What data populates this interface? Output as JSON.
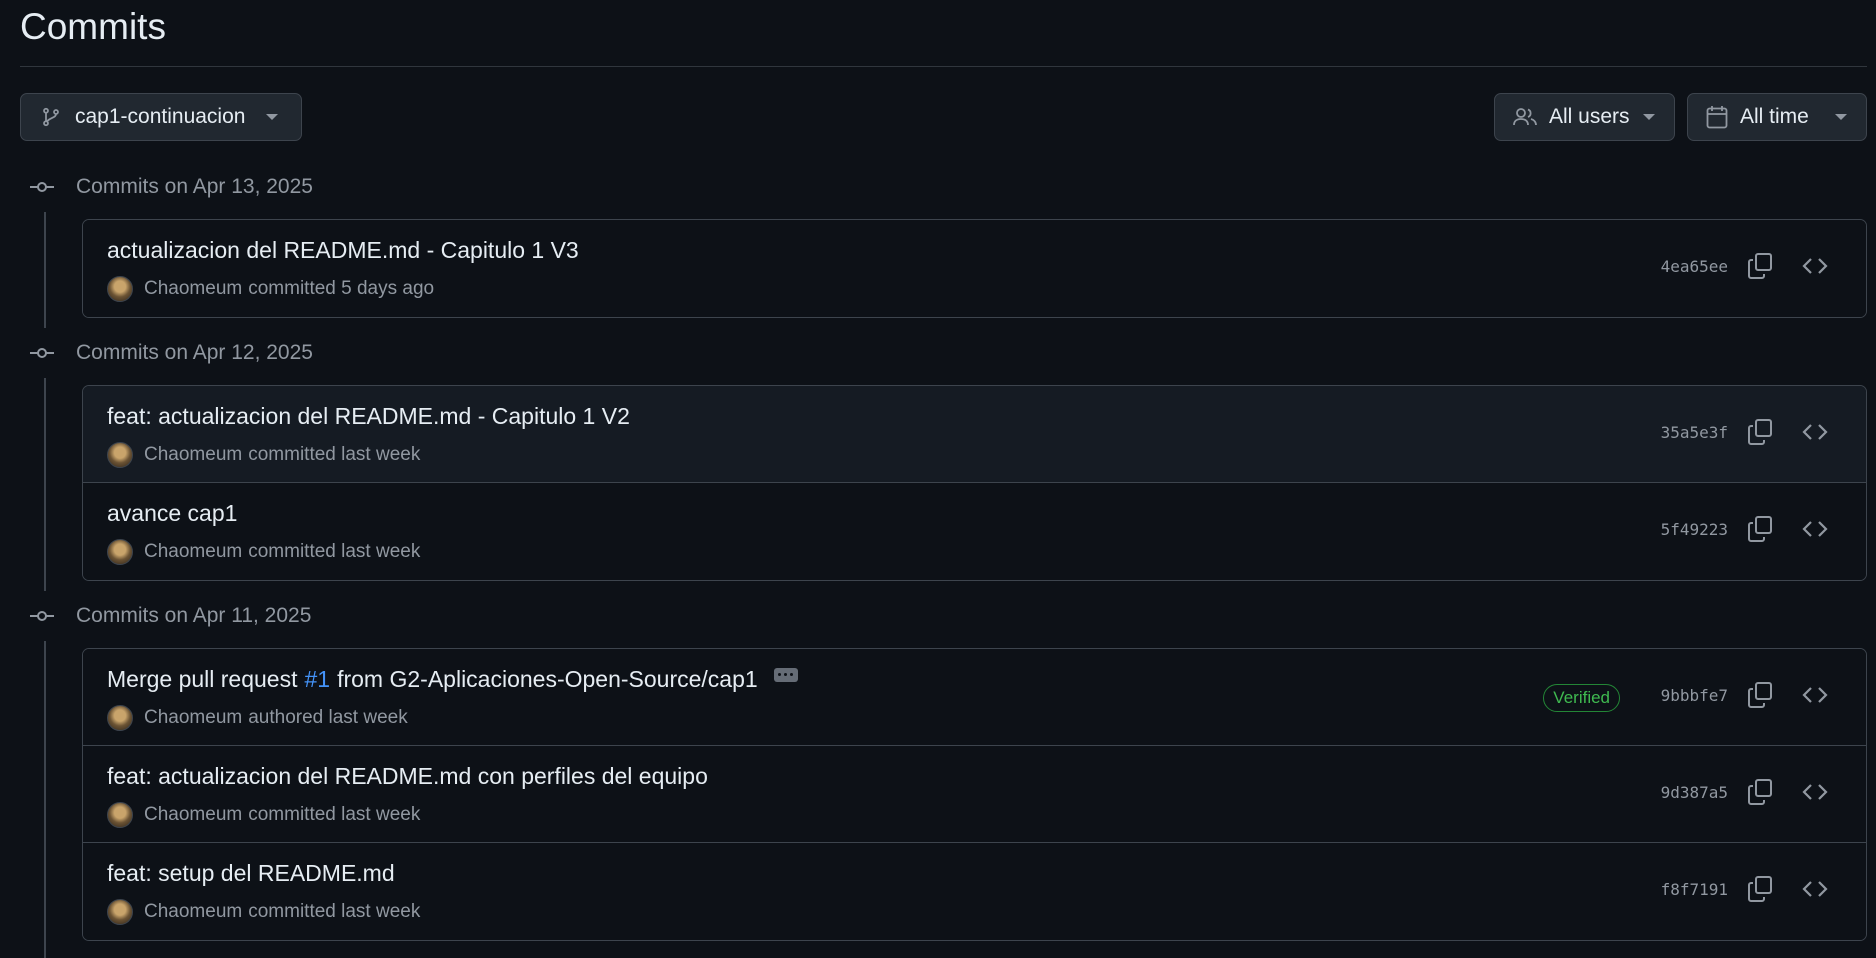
{
  "page": {
    "title": "Commits"
  },
  "filters": {
    "branch": "cap1-continuacion",
    "users": "All users",
    "time": "All time"
  },
  "groups": [
    {
      "date_label": "Commits on Apr 13, 2025",
      "commits": [
        {
          "message": "actualizacion del README.md - Capitulo 1 V3",
          "author": "Chaomeum",
          "action": "committed 5 days ago",
          "sha": "4ea65ee"
        }
      ]
    },
    {
      "date_label": "Commits on Apr 12, 2025",
      "commits": [
        {
          "message": "feat: actualizacion del README.md - Capitulo 1 V2",
          "author": "Chaomeum",
          "action": "committed last week",
          "sha": "35a5e3f"
        },
        {
          "message": "avance cap1",
          "author": "Chaomeum",
          "action": "committed last week",
          "sha": "5f49223"
        }
      ]
    },
    {
      "date_label": "Commits on Apr 11, 2025",
      "commits": [
        {
          "message_prefix": "Merge pull request",
          "pr_link": "#1",
          "message_suffix": "from G2-Aplicaciones-Open-Source/cap1",
          "author": "Chaomeum",
          "action": "authored last week",
          "badge": "Verified",
          "sha": "9bbbfe7"
        },
        {
          "message": "feat: actualizacion del README.md con perfiles del equipo",
          "author": "Chaomeum",
          "action": "committed last week",
          "sha": "9d387a5"
        },
        {
          "message": "feat: setup del README.md",
          "author": "Chaomeum",
          "action": "committed last week",
          "sha": "f8f7191"
        }
      ]
    }
  ],
  "colors": {
    "background": "#0d1117",
    "link": "#4493f8",
    "verified": "#3fb950",
    "muted": "#9198a1"
  }
}
